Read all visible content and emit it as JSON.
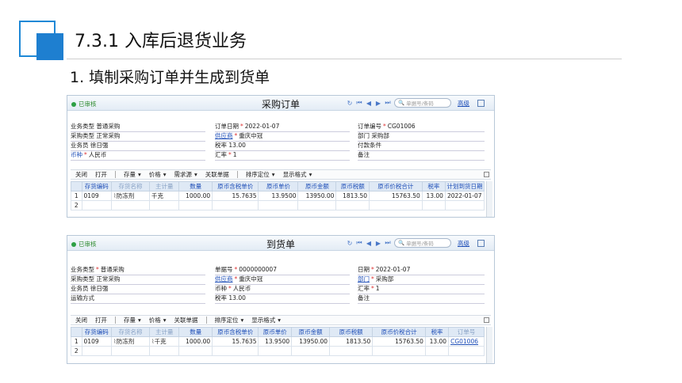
{
  "slide": {
    "title": "7.3.1  入库后退货业务",
    "subtitle": "1. 填制采购订单并生成到货单"
  },
  "colors": {
    "accent": "#1e7fd0",
    "link": "#1f4fb8",
    "status": "#2ea044"
  },
  "purchase_order": {
    "status": "已审核",
    "title": "采购订单",
    "search_placeholder": "单据号/条码",
    "advanced": "高级",
    "fields": {
      "biz_type_label": "业务类型",
      "biz_type": "普通采购",
      "order_date_label": "订单日期",
      "order_date": "2022-01-07",
      "order_no_label": "订单编号",
      "order_no": "CG01006",
      "purchase_type_label": "采购类型",
      "purchase_type": "正常采购",
      "supplier_label": "供应商",
      "supplier": "重庆中冠",
      "dept_label": "部门",
      "dept": "采购部",
      "staff_label": "业务员",
      "staff": "徐日强",
      "tax_rate_label": "税率",
      "tax_rate": "13.00",
      "pay_terms_label": "付款条件",
      "pay_terms": "",
      "currency_label": "币种",
      "currency": "人民币",
      "exchange_label": "汇率",
      "exchange": "1",
      "remark_label": "备注",
      "remark": ""
    },
    "toolbar": [
      "关闭",
      "打开",
      "存量",
      "价格",
      "需求源",
      "关联单据",
      "排序定位",
      "显示格式"
    ],
    "columns": [
      "",
      "存货编码",
      "存货名称",
      "主计量",
      "数量",
      "原币含税单价",
      "原币单价",
      "原币金额",
      "原币税额",
      "原币价税合计",
      "税率",
      "计划到货日期"
    ],
    "rows": [
      [
        "1",
        "0109",
        "防冻剂",
        "千克",
        "1000.00",
        "15.7635",
        "13.9500",
        "13950.00",
        "1813.50",
        "15763.50",
        "13.00",
        "2022-01-07"
      ],
      [
        "2",
        "",
        "",
        "",
        "",
        "",
        "",
        "",
        "",
        "",
        "",
        ""
      ]
    ]
  },
  "arrival": {
    "status": "已审核",
    "title": "到货单",
    "search_placeholder": "单据号/条码",
    "advanced": "高级",
    "fields": {
      "biz_type_label": "业务类型",
      "biz_type": "普通采购",
      "doc_no_label": "单据号",
      "doc_no": "0000000007",
      "date_label": "日期",
      "date": "2022-01-07",
      "purchase_type_label": "采购类型",
      "purchase_type": "正常采购",
      "supplier_label": "供应商",
      "supplier": "重庆中冠",
      "dept_label": "部门",
      "dept": "采购部",
      "staff_label": "业务员",
      "staff": "徐日强",
      "currency_label": "币种",
      "currency": "人民币",
      "exchange_label": "汇率",
      "exchange": "1",
      "transport_label": "运输方式",
      "transport": "",
      "tax_rate_label": "税率",
      "tax_rate": "13.00",
      "remark_label": "备注",
      "remark": ""
    },
    "toolbar": [
      "关闭",
      "打开",
      "存量",
      "价格",
      "关联单据",
      "排序定位",
      "显示格式"
    ],
    "columns": [
      "",
      "存货编码",
      "存货名称",
      "主计量",
      "数量",
      "原币含税单价",
      "原币单价",
      "原币金额",
      "原币税额",
      "原币价税合计",
      "税率",
      "订单号"
    ],
    "rows": [
      [
        "1",
        "0109",
        "防冻剂",
        "千克",
        "1000.00",
        "15.7635",
        "13.9500",
        "13950.00",
        "1813.50",
        "15763.50",
        "13.00",
        "CG01006"
      ],
      [
        "2",
        "",
        "",
        "",
        "",
        "",
        "",
        "",
        "",
        "",
        "",
        ""
      ]
    ]
  }
}
